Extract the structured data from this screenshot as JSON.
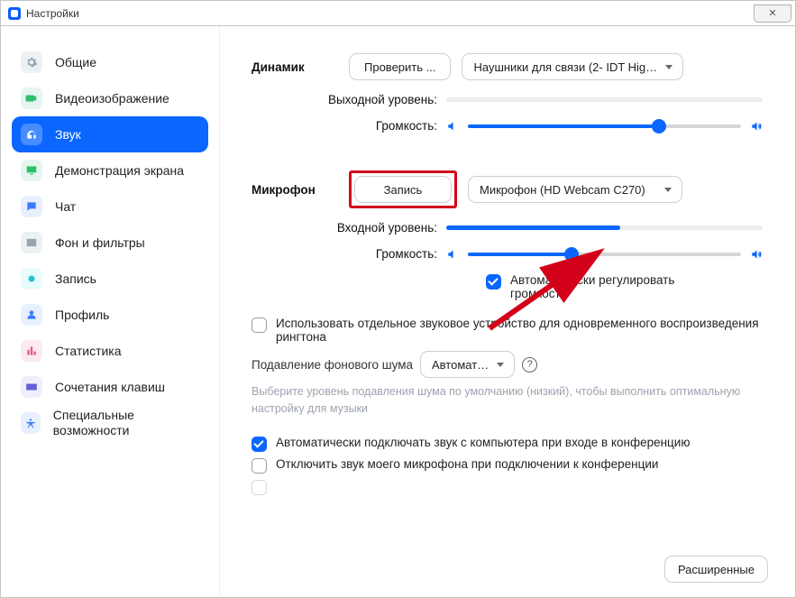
{
  "window": {
    "title": "Настройки"
  },
  "sidebar": {
    "items": [
      {
        "label": "Общие"
      },
      {
        "label": "Видеоизображение"
      },
      {
        "label": "Звук"
      },
      {
        "label": "Демонстрация экрана"
      },
      {
        "label": "Чат"
      },
      {
        "label": "Фон и фильтры"
      },
      {
        "label": "Запись"
      },
      {
        "label": "Профиль"
      },
      {
        "label": "Статистика"
      },
      {
        "label": "Сочетания клавиш"
      },
      {
        "label": "Специальные возможности"
      }
    ]
  },
  "speaker": {
    "section": "Динамик",
    "test_btn": "Проверить ...",
    "device": "Наушники для связи (2- IDT Hig…",
    "output_label": "Выходной уровень:",
    "output_fill_pct": 0,
    "volume_label": "Громкость:",
    "volume_pct": 70
  },
  "mic": {
    "section": "Микрофон",
    "record_btn": "Запись",
    "device": "Микрофон (HD Webcam C270)",
    "input_label": "Входной уровень:",
    "input_fill_pct": 55,
    "volume_label": "Громкость:",
    "volume_pct": 38,
    "auto_gain": "Автоматически регулировать громкость"
  },
  "opts": {
    "separate_device": "Использовать отдельное звуковое устройство для одновременного воспроизведения рингтона",
    "noise_label": "Подавление фонового шума",
    "noise_value": "Автомат…",
    "noise_hint": "Выберите уровень подавления шума по умолчанию (низкий), чтобы выполнить оптимальную настройку для музыки",
    "auto_join": "Автоматически подключать звук с компьютера при входе в конференцию",
    "mute_on_join": "Отключить звук моего микрофона при подключении к конференции"
  },
  "footer": {
    "advanced": "Расширенные"
  }
}
